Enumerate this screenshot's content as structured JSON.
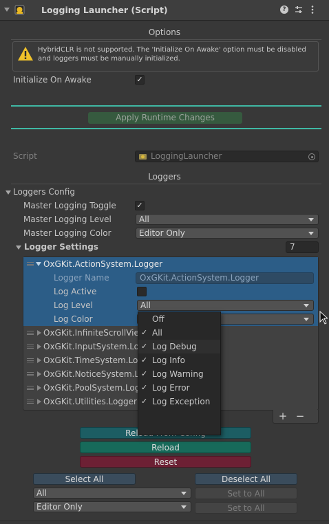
{
  "header": {
    "title": "Logging Launcher (Script)"
  },
  "options": {
    "section_title": "Options",
    "warning_text": "HybridCLR is not supported. The 'Initialize On Awake' option must be disabled and loggers must be manually initialized.",
    "initialize_on_awake_label": "Initialize On Awake",
    "apply_button": "Apply Runtime Changes"
  },
  "script": {
    "label": "Script",
    "value": "LoggingLauncher"
  },
  "loggers": {
    "section_title": "Loggers",
    "config_label": "Loggers Config",
    "master_toggle_label": "Master Logging Toggle",
    "master_level_label": "Master Logging Level",
    "master_level_value": "All",
    "master_color_label": "Master Logging Color",
    "master_color_value": "Editor Only",
    "settings_label": "Logger Settings",
    "settings_count": "7"
  },
  "expanded_logger": {
    "title": "OxGKit.ActionSystem.Logger",
    "name_label": "Logger Name",
    "name_value": "OxGKit.ActionSystem.Logger",
    "active_label": "Log Active",
    "level_label": "Log Level",
    "level_value": "All",
    "color_label": "Log Color"
  },
  "logger_items": [
    {
      "label": "OxGKit.InfiniteScrollView.Logger"
    },
    {
      "label": "OxGKit.InputSystem.Logger"
    },
    {
      "label": "OxGKit.TimeSystem.Logger"
    },
    {
      "label": "OxGKit.NoticeSystem.Logger"
    },
    {
      "label": "OxGKit.PoolSystem.Logger"
    },
    {
      "label": "OxGKit.Utilities.Logger"
    }
  ],
  "popup_options": [
    {
      "label": "Off",
      "checked": false
    },
    {
      "label": "All",
      "checked": true
    },
    {
      "label": "Log Debug",
      "checked": true
    },
    {
      "label": "Log Info",
      "checked": true
    },
    {
      "label": "Log Warning",
      "checked": true
    },
    {
      "label": "Log Error",
      "checked": true
    },
    {
      "label": "Log Exception",
      "checked": true
    }
  ],
  "list_controls": {
    "add": "+",
    "remove": "−"
  },
  "actions": {
    "reload_from_config": "Reload From Config",
    "reload": "Reload",
    "reset": "Reset",
    "select_all": "Select All",
    "deselect_all": "Deselect All",
    "bottom_level_value": "All",
    "bottom_color_value": "Editor Only",
    "set_to_all_1": "Set to All",
    "set_to_all_2": "Set to All"
  },
  "colors": {
    "accent_teal": "#3fb9a4",
    "selection_blue": "#2c5d87",
    "reload_green": "#176a5a",
    "reset_red": "#6d2034",
    "reload_config_teal": "#1c5d63"
  }
}
